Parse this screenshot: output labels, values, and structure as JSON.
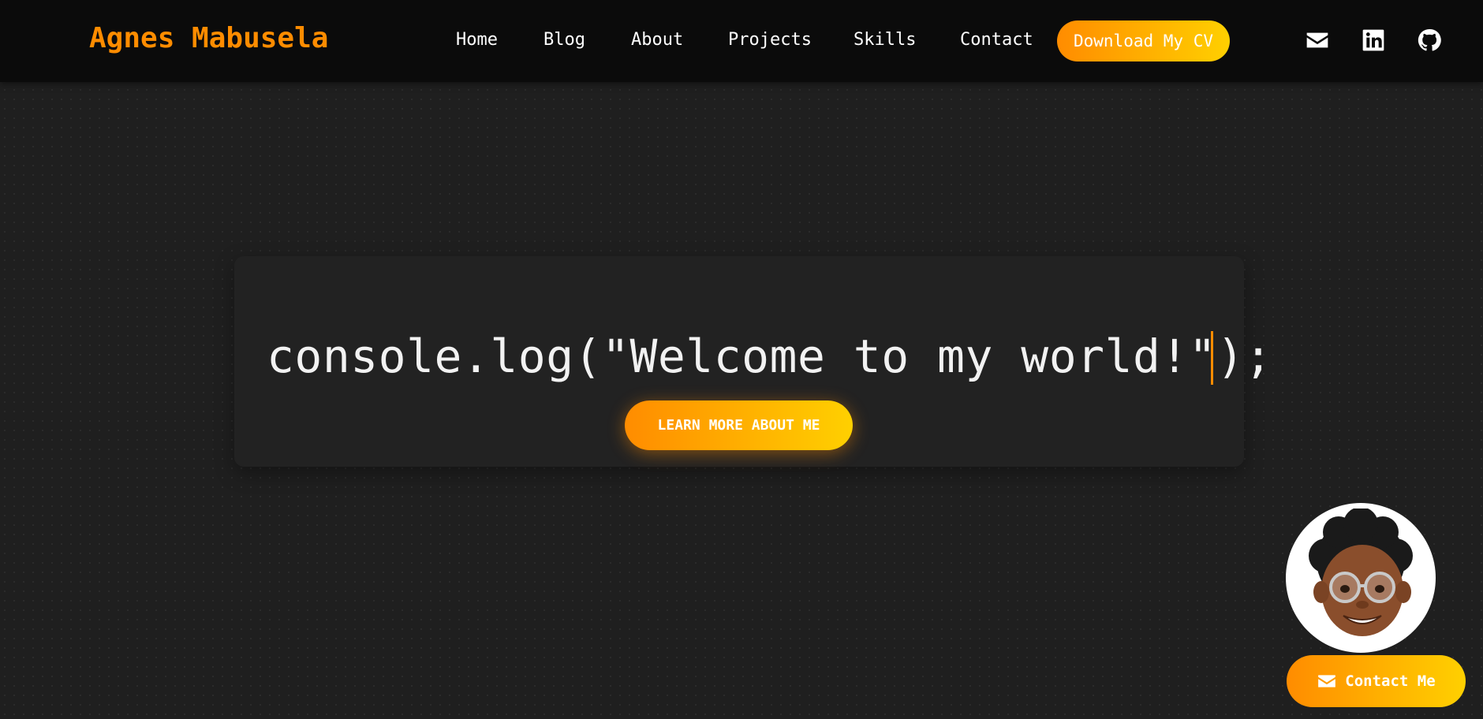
{
  "header": {
    "brand": "Agnes Mabusela",
    "nav": [
      {
        "label": "Home"
      },
      {
        "label": "Blog"
      },
      {
        "label": "About"
      },
      {
        "label": "Projects"
      },
      {
        "label": "Skills"
      },
      {
        "label": "Contact"
      }
    ],
    "cv_button": "Download My CV",
    "social_icons": [
      "envelope-icon",
      "linkedin-icon",
      "github-icon"
    ]
  },
  "hero": {
    "code_text": "console.log(\"Welcome to my world!\");",
    "button": "LEARN MORE ABOUT ME"
  },
  "floating": {
    "avatar_icon": "memoji-avatar",
    "contact_button": "Contact Me"
  },
  "colors": {
    "accent": "#ff8c00",
    "accent_end": "#ffd000",
    "background": "#1f1f1f",
    "header": "#0b0b0b"
  }
}
